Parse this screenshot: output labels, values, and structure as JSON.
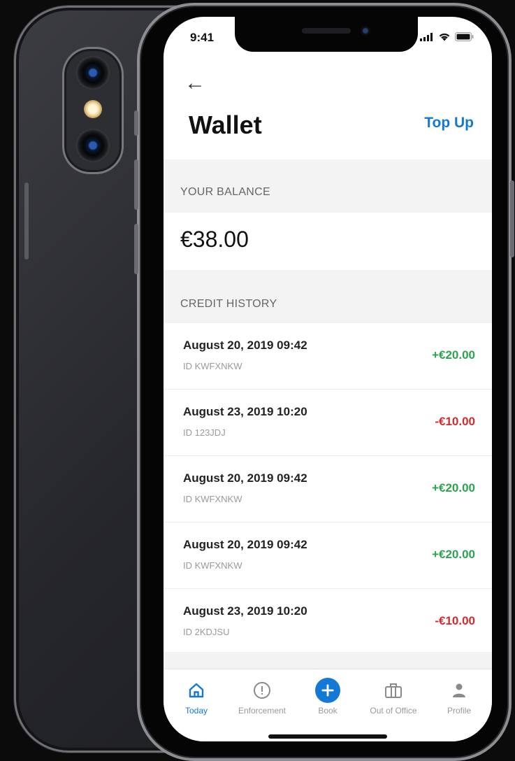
{
  "status_bar": {
    "time": "9:41"
  },
  "header": {
    "title": "Wallet",
    "action_label": "Top Up"
  },
  "balance": {
    "section_label": "YOUR BALANCE",
    "amount": "€38.00"
  },
  "history": {
    "section_label": "CREDIT HISTORY",
    "items": [
      {
        "date": "August 20, 2019 09:42",
        "id": "ID KWFXNKW",
        "amount": "+€20.00",
        "type": "credit"
      },
      {
        "date": "August 23, 2019 10:20",
        "id": "ID 123JDJ",
        "amount": "-€10.00",
        "type": "debit"
      },
      {
        "date": "August 20, 2019 09:42",
        "id": "ID KWFXNKW",
        "amount": "+€20.00",
        "type": "credit"
      },
      {
        "date": "August 20, 2019 09:42",
        "id": "ID KWFXNKW",
        "amount": "+€20.00",
        "type": "credit"
      },
      {
        "date": "August 23, 2019 10:20",
        "id": "ID 2KDJSU",
        "amount": "-€10.00",
        "type": "debit"
      }
    ]
  },
  "tab_bar": {
    "tabs": [
      {
        "label": "Today",
        "icon": "home-icon",
        "active": true
      },
      {
        "label": "Enforcement",
        "icon": "alert-circle-icon",
        "active": false
      },
      {
        "label": "Book",
        "icon": "plus-circle-icon",
        "active": false
      },
      {
        "label": "Out of Office",
        "icon": "briefcase-icon",
        "active": false
      },
      {
        "label": "Profile",
        "icon": "person-icon",
        "active": false
      }
    ]
  },
  "colors": {
    "accent": "#1479d6",
    "positive": "#2ba34f",
    "negative": "#d5292c",
    "section_background": "#f3f3f4"
  }
}
